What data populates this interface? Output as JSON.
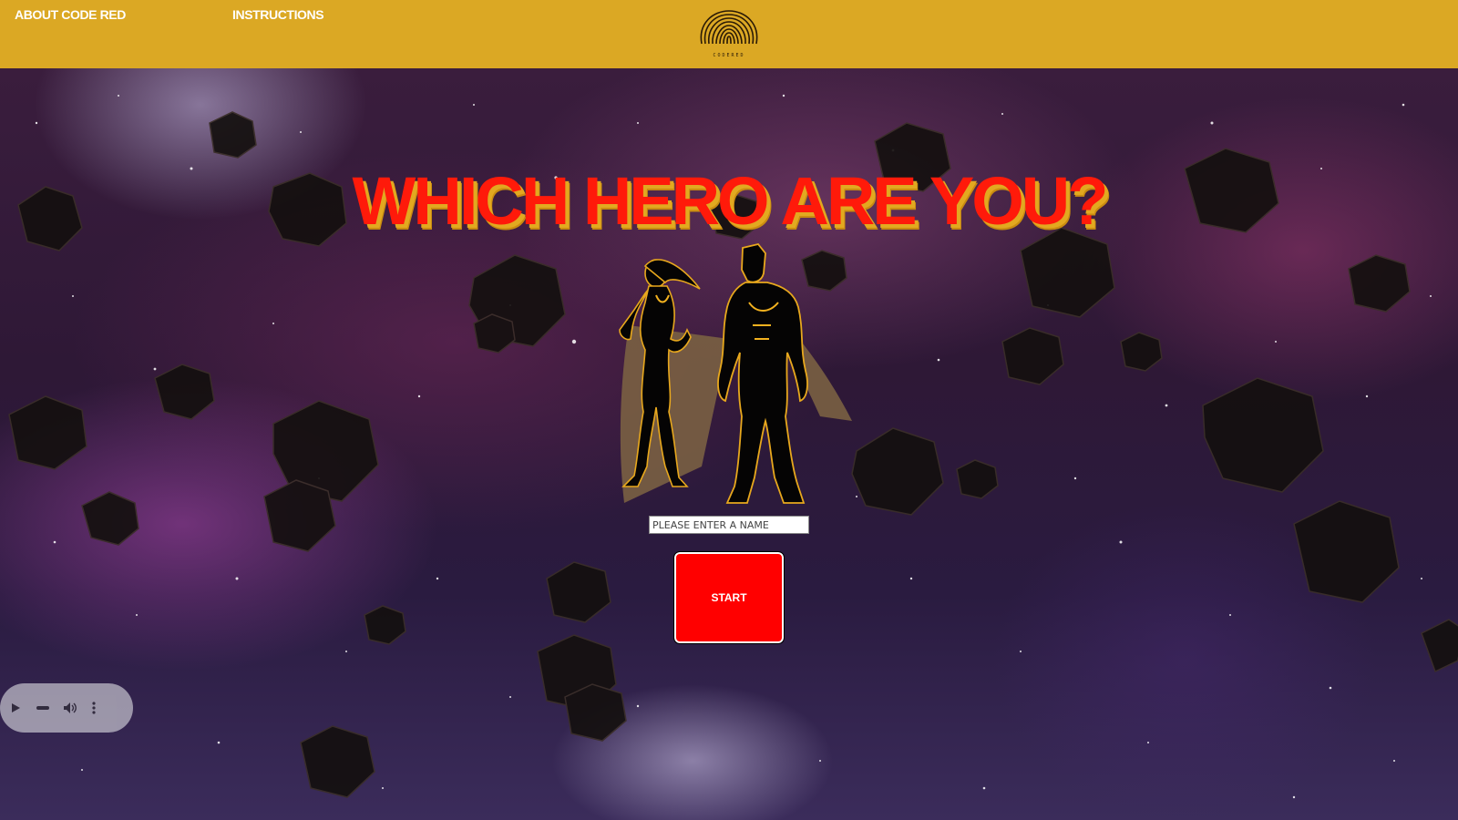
{
  "nav": {
    "about_label": "ABOUT CODE RED",
    "instructions_label": "INSTRUCTiONS"
  },
  "logo": {
    "text": "CODERED",
    "icon": "fingerprint-icon"
  },
  "hero": {
    "headline": "WHICH HERO ARE YOU?",
    "image": "superhero-duo-silhouette"
  },
  "form": {
    "name_placeholder": "PLEASE ENTER A NAME",
    "name_value": "",
    "start_label": "START"
  },
  "audio_player": {
    "icons": [
      "play-icon",
      "progress-bar",
      "volume-icon",
      "more-options-icon"
    ]
  },
  "colors": {
    "topbar": "#dba824",
    "headline": "#ff1a0a",
    "headline_shadow": "#e2a920",
    "start_button": "#ff0000"
  }
}
